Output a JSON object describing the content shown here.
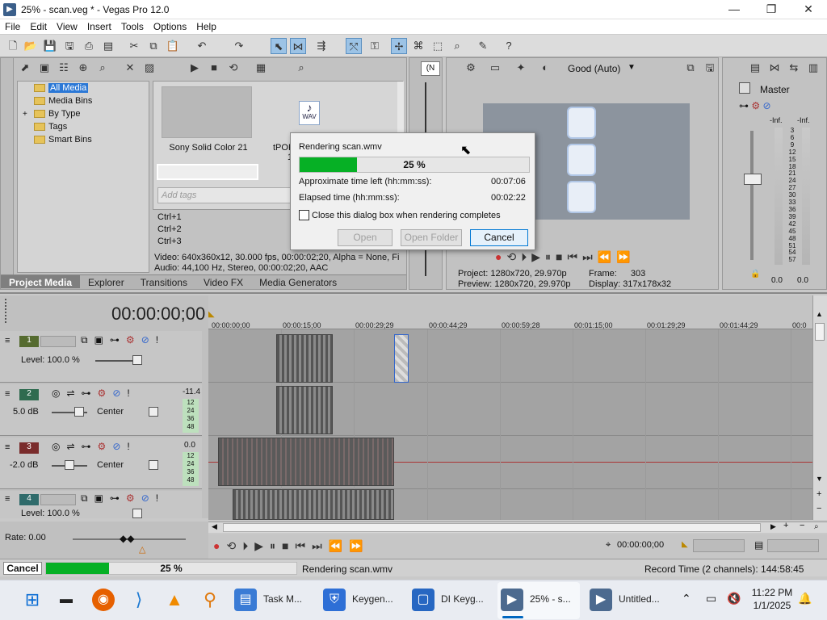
{
  "window": {
    "title": "25% - scan.veg * - Vegas Pro 12.0",
    "minimize": "—",
    "maximize": "❐",
    "close": "✕"
  },
  "menu": [
    "File",
    "Edit",
    "View",
    "Insert",
    "Tools",
    "Options",
    "Help"
  ],
  "explorer": {
    "tree": [
      {
        "label": "All Media",
        "selected": true
      },
      {
        "label": "Media Bins"
      },
      {
        "label": "By Type",
        "expand": "+"
      },
      {
        "label": "Tags"
      },
      {
        "label": "Smart Bins"
      }
    ],
    "thumbs": [
      {
        "label": "Sony Solid Color 21"
      },
      {
        "label": "tPOR",
        "sub": "1"
      }
    ],
    "wav_label": "WAV",
    "tags_placeholder": "Add tags",
    "shortcuts": [
      "Ctrl+1",
      "Ctrl+2",
      "Ctrl+3"
    ],
    "info1": "Video: 640x360x12, 30.000 fps, 00:00:02;20, Alpha = None, Fi",
    "info2": "Audio: 44,100 Hz, Stereo, 00:00:02;20, AAC",
    "tabs": [
      "Project Media",
      "Explorer",
      "Transitions",
      "Video FX",
      "Media Generators"
    ]
  },
  "trimmer": {
    "label": "(N"
  },
  "preview": {
    "quality": "Good (Auto)",
    "project_label": "Project:",
    "project": "1280x720, 29.970p",
    "preview_label": "Preview:",
    "preview": "1280x720, 29.970p",
    "frame_label": "Frame:",
    "frame": "303",
    "display_label": "Display:",
    "display": "317x178x32"
  },
  "master": {
    "title": "Master",
    "left_top": "-Inf.",
    "right_top": "-Inf.",
    "scale": [
      "3",
      "6",
      "9",
      "12",
      "15",
      "18",
      "21",
      "24",
      "27",
      "30",
      "33",
      "36",
      "39",
      "42",
      "45",
      "48",
      "51",
      "54",
      "57"
    ],
    "left_bottom": "0.0",
    "right_bottom": "0.0"
  },
  "render_dialog": {
    "title": "Rendering scan.wmv",
    "progress_percent": 25,
    "progress_label": "25 %",
    "time_left_label": "Approximate time left (hh:mm:ss):",
    "time_left": "00:07:06",
    "elapsed_label": "Elapsed time (hh:mm:ss):",
    "elapsed": "00:02:22",
    "close_checkbox": "Close this dialog box when rendering completes",
    "open_btn": "Open",
    "open_folder_btn": "Open Folder",
    "cancel_btn": "Cancel"
  },
  "timeline": {
    "timecode": "00:00:00;00",
    "ruler": [
      "00:00:00;00",
      "00:00:15;00",
      "00:00:29;29",
      "00:00:44;29",
      "00:00:59;28",
      "00:01:15;00",
      "00:01:29;29",
      "00:01:44;29",
      "00:0"
    ],
    "tracks": [
      {
        "num": "1",
        "type": "video",
        "level": "Level: 100.0 %"
      },
      {
        "num": "2",
        "type": "audio",
        "vol": "5.0 dB",
        "pan": "Center",
        "peak": "-11.4",
        "meter": [
          "12",
          "24",
          "36",
          "48"
        ]
      },
      {
        "num": "3",
        "type": "audio",
        "vol": "-2.0 dB",
        "pan": "Center",
        "peak": "0.0",
        "meter": [
          "12",
          "24",
          "36",
          "48"
        ]
      },
      {
        "num": "4",
        "type": "video",
        "level": "Level: 100.0 %"
      }
    ],
    "rate": "Rate: 0.00",
    "cursor_time": "00:00:00;00"
  },
  "statusbar": {
    "cancel": "Cancel",
    "progress_percent": 25,
    "progress_label": "25 %",
    "status": "Rendering scan.wmv",
    "record_time": "Record Time (2 channels): 144:58:45"
  },
  "taskbar": {
    "items": [
      {
        "label": "Task M..."
      },
      {
        "label": "Keygen..."
      },
      {
        "label": "DI Keyg..."
      },
      {
        "label": "25% - s..."
      },
      {
        "label": "Untitled..."
      }
    ],
    "time": "11:22 PM",
    "date": "1/1/2025"
  },
  "colors": {
    "accent": "#06b025",
    "selection": "#2b78d6",
    "taskbar": "#e9ecf2"
  }
}
